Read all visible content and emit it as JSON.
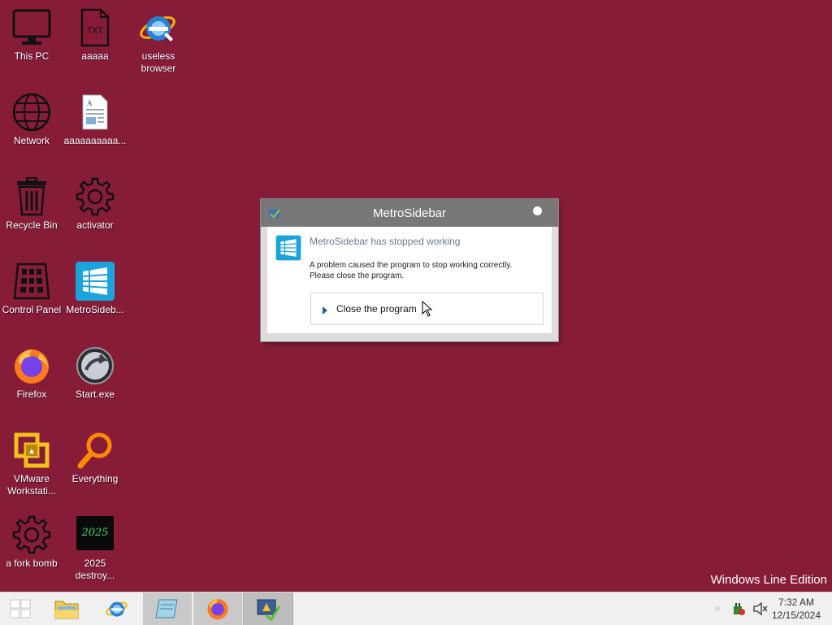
{
  "desktop": {
    "background_color": "#871c39",
    "icons": [
      {
        "label": "This PC",
        "icon": "computer-icon"
      },
      {
        "label": "aaaaa",
        "icon": "txt-file-icon"
      },
      {
        "label": "useless browser",
        "icon": "internet-explorer-icon"
      },
      {
        "label": "Network",
        "icon": "globe-icon"
      },
      {
        "label": "aaaaaaaaaa...",
        "icon": "document-icon"
      },
      {
        "label": "Recycle Bin",
        "icon": "recycle-bin-icon"
      },
      {
        "label": "activator",
        "icon": "gear-icon"
      },
      {
        "label": "Control Panel",
        "icon": "control-panel-icon"
      },
      {
        "label": "MetroSideb...",
        "icon": "metrosidebar-icon"
      },
      {
        "label": "Firefox",
        "icon": "firefox-icon"
      },
      {
        "label": "Start.exe",
        "icon": "start-exe-icon"
      },
      {
        "label": "VMware Workstati...",
        "icon": "vmware-icon"
      },
      {
        "label": "Everything",
        "icon": "magnifier-icon"
      },
      {
        "label": "a fork bomb",
        "icon": "gear-icon"
      },
      {
        "label": "2025 destroy...",
        "icon": "image-2025-icon"
      }
    ],
    "watermark": "Windows Line Edition"
  },
  "dialog": {
    "title": "MetroSidebar",
    "heading": "MetroSidebar has stopped working",
    "message_line1": "A problem caused the program to stop working correctly.",
    "message_line2": "Please close the program.",
    "command_label": "Close the program"
  },
  "taskbar": {
    "items": [
      "start-button",
      "file-explorer",
      "internet-explorer",
      "notepad",
      "firefox",
      "error-reporting"
    ],
    "time": "7:32 AM",
    "date": "12/15/2024"
  }
}
